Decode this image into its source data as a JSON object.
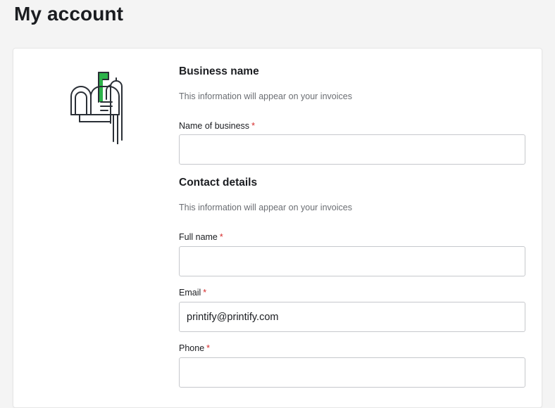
{
  "page": {
    "title": "My account"
  },
  "illustration": {
    "icon": "mailbox-icon",
    "accent_color": "#2cb34a"
  },
  "business_section": {
    "title": "Business name",
    "subtitle": "This information will appear on your invoices",
    "fields": [
      {
        "label": "Name of business",
        "required_mark": "*",
        "value": ""
      }
    ]
  },
  "contact_section": {
    "title": "Contact details",
    "subtitle": "This information will appear on your invoices",
    "fields": [
      {
        "label": "Full name",
        "required_mark": "*",
        "value": ""
      },
      {
        "label": "Email",
        "required_mark": "*",
        "value": "printify@printify.com"
      },
      {
        "label": "Phone",
        "required_mark": "*",
        "value": ""
      }
    ]
  },
  "colors": {
    "required": "#d62b2b",
    "text_primary": "#1b1d21",
    "text_secondary": "#6b6e73",
    "input_border": "#c6c8cc"
  }
}
